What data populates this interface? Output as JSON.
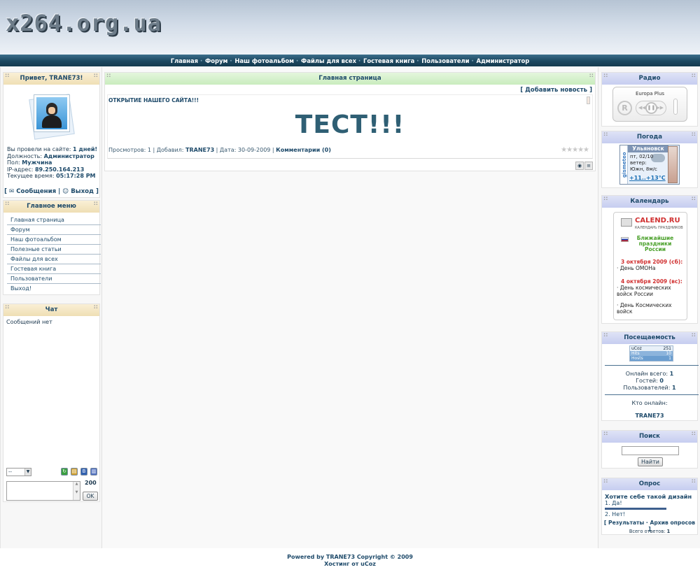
{
  "site": {
    "logo": "x264.org.ua"
  },
  "nav": [
    "Главная",
    "Форум",
    "Наш фотоальбом",
    "Файлы для всех",
    "Гостевая книга",
    "Пользователи",
    "Администратор"
  ],
  "user_block": {
    "title": "Привет, TRANE73!",
    "time_label": "Вы провели на сайте:",
    "time_value": "1 дней!",
    "role_label": "Должность:",
    "role_value": "Администратор",
    "sex_label": "Пол:",
    "sex_value": "Мужчина",
    "ip_label": "IP-адрес:",
    "ip_value": "89.250.164.213",
    "clock_label": "Текущее время:",
    "clock_value": "05:17:28 PM",
    "messages": "Сообщения",
    "logout": "Выход"
  },
  "main_menu": {
    "title": "Главное меню",
    "items": [
      "Главная страница",
      "Форум",
      "Наш фотоальбом",
      "Полезные статьи",
      "Файлы для всех",
      "Гостевая книга",
      "Пользователи",
      "Выход!"
    ]
  },
  "chat": {
    "title": "Чат",
    "empty": "Сообщений нет",
    "select_value": "--",
    "counter": "200",
    "ok": "OK"
  },
  "main": {
    "title": "Главная страница",
    "add_news": "[ Добавить новость ]",
    "news_title": "ОТКРЫТИЕ НАШЕГО САЙТА!!!",
    "news_body": "ТЕСТ!!!",
    "views_label": "Просмотров:",
    "views": "1",
    "added_label": "Добавил:",
    "author": "TRANE73",
    "date_label": "Дата:",
    "date": "30-09-2009",
    "comments": "Комментарии (0)"
  },
  "radio": {
    "title": "Радио",
    "station": "Europa Plus"
  },
  "weather": {
    "title": "Погода",
    "brand": "gismeteo",
    "city": "Ульяновск",
    "date": "пт, 02/10",
    "wind_label": "ветер:",
    "wind": "Южн, 8м/с",
    "temp": "+11..+13°C"
  },
  "calendar": {
    "title": "Календарь",
    "brand": "CALEND.RU",
    "subtitle": "КАЛЕНДАРЬ ПРАЗДНИКОВ",
    "heading": "Ближайшие праздники России",
    "date1": "3 октября 2009 (сб):",
    "event1": "· День ОМОНа",
    "date2": "4 октября 2009 (вс):",
    "event2": "· День космических войск России",
    "event3": "· День Космических войск"
  },
  "stats": {
    "title": "Посещаемость",
    "counter_rows": [
      {
        "label": "uCoz",
        "value": "251"
      },
      {
        "label": "Hits",
        "value": "10"
      },
      {
        "label": "Hosts",
        "value": "1"
      }
    ],
    "online_total_label": "Онлайн всего:",
    "online_total": "1",
    "guests_label": "Гостей:",
    "guests": "0",
    "users_label": "Пользователей:",
    "users": "1",
    "who_online": "Кто онлайн:",
    "online_user": "TRANE73"
  },
  "search": {
    "title": "Поиск",
    "button": "Найти"
  },
  "poll": {
    "title": "Опрос",
    "question": "Хотите себе такой дизайн",
    "options": [
      "1. Да!",
      "2. Нет!"
    ],
    "option1_share": 1.0,
    "results": "Результаты",
    "archive": "Архив опросов",
    "total_label": "Всего ответов:",
    "total": "1"
  },
  "footer": {
    "powered": "Powered by",
    "owner": "TRANE73",
    "copyright": "Copyright © 2009",
    "hosting": "Хостинг от uCoz"
  },
  "colors": {
    "nav_bg": "#1c4860",
    "text": "#1e4a6a",
    "accent_green": "#4aa02a",
    "accent_red": "#d03030"
  }
}
